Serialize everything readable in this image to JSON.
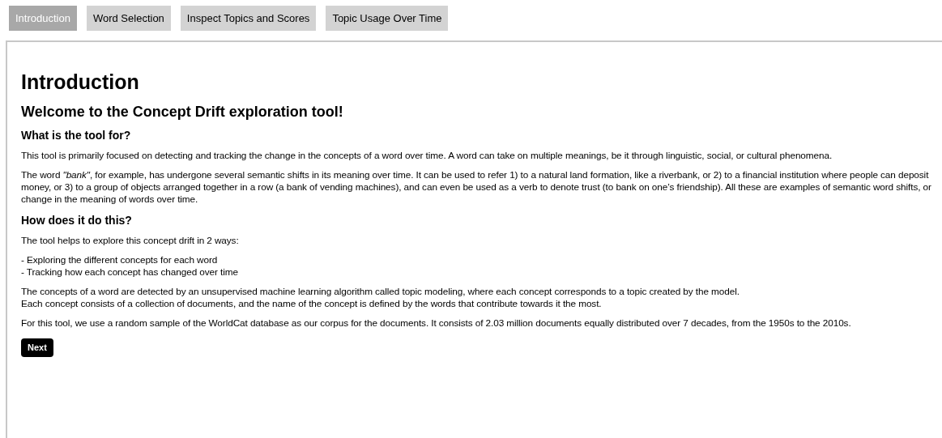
{
  "tabs": [
    {
      "label": "Introduction",
      "selected": true
    },
    {
      "label": "Word Selection",
      "selected": false
    },
    {
      "label": "Inspect Topics and Scores",
      "selected": false
    },
    {
      "label": "Topic Usage Over Time",
      "selected": false
    }
  ],
  "page": {
    "title": "Introduction",
    "subtitle": "Welcome to the Concept Drift exploration tool!",
    "sections": [
      {
        "heading": "What is the tool for?",
        "paragraphs": [
          [
            "This tool is primarily focused on detecting and tracking the change in the concepts of a word over time. A word can take on multiple meanings, be it through linguistic, social, or cultural phenomena."
          ],
          [
            "The word *\"bank\"*, for example, has undergone several semantic shifts in its meaning over time. It can be used to refer 1) to a natural land formation, like a riverbank, or 2) to a financial institution where people can deposit money, or 3) to a group of objects arranged together in a row (a bank of vending machines), and can even be used as a verb to denote trust (to bank on one’s friendship). All these are examples of semantic word shifts, or change in the meaning of words over time."
          ]
        ]
      },
      {
        "heading": "How does it do this?",
        "paragraphs": [
          [
            "The tool helps to explore this concept drift in 2 ways:"
          ],
          [
            "- Exploring the different concepts for each word",
            "- Tracking how each concept has changed over time"
          ],
          [
            "The concepts of a word are detected by an unsupervised machine learning algorithm called topic modeling, where each concept corresponds to a topic created by the model.",
            "Each concept consists of a collection of documents, and the name of the concept is defined by the words that contribute towards it the most."
          ],
          [
            "For this tool, we use a random sample of the WorldCat database as our corpus for the documents. It consists of 2.03 million documents equally distributed over 7 decades, from the 1950s to the 2010s."
          ]
        ]
      }
    ],
    "next_button": "Next"
  }
}
